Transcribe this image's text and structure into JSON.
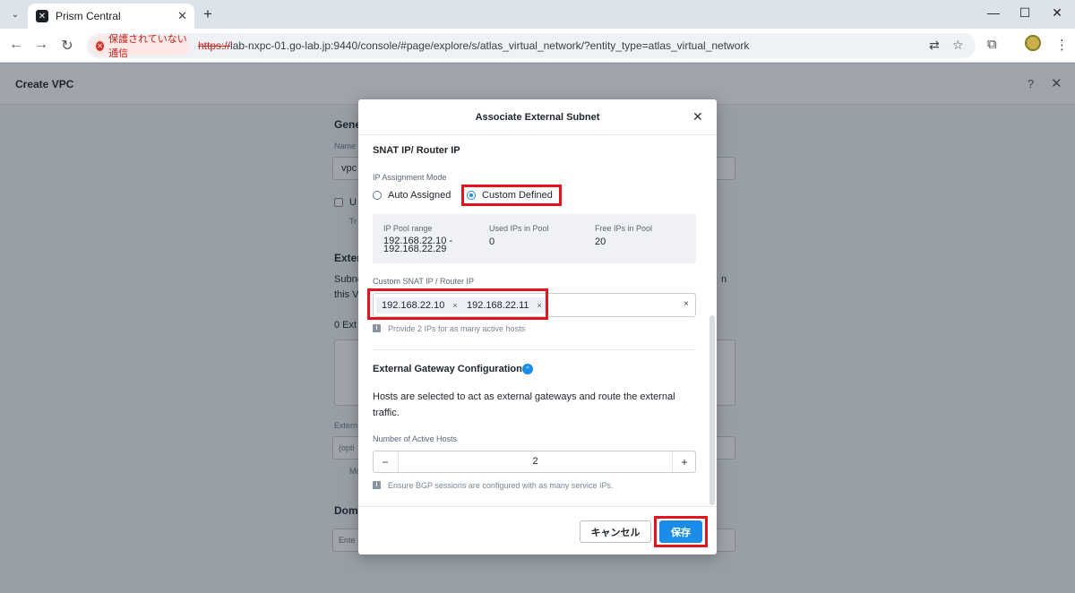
{
  "browser": {
    "tab_title": "Prism Central",
    "security_label": "保護されていない通信",
    "url_scheme": "https://",
    "url_rest": "lab-nxpc-01.go-lab.jp:9440/console/#page/explore/s/atlas_virtual_network/?entity_type=atlas_virtual_network"
  },
  "page": {
    "title": "Create VPC",
    "help": "?",
    "bg_general": "Gene",
    "bg_name_label": "Name",
    "bg_name_value": "vpc",
    "bg_use_label": "U",
    "bg_tr": "Tr",
    "bg_external": "Exter",
    "bg_subnet_line1": "Subne",
    "bg_subnet_line2": "this V",
    "bg_zero_ext": "0 Ext",
    "bg_ext_label": "Extern",
    "bg_opt": "(opti",
    "bg_mo": "Mo",
    "bg_domain": "Doma",
    "bg_enter": "Ente",
    "bg_right_frag1": "n",
    "bg_right_frag2": "o"
  },
  "modal": {
    "title": "Associate External Subnet",
    "snat_title": "SNAT IP/ Router IP",
    "ip_mode_label": "IP Assignment Mode",
    "auto_assigned": "Auto Assigned",
    "custom_defined": "Custom Defined",
    "selected_mode": "Custom Defined",
    "pool_range_label": "IP Pool range",
    "pool_range_value_1": "192.168.22.10 -",
    "pool_range_value_2": "192.168.22.29",
    "used_ips_label": "Used IPs in Pool",
    "used_ips_value": "0",
    "free_ips_label": "Free IPs in Pool",
    "free_ips_value": "20",
    "custom_snat_label": "Custom SNAT IP / Router IP",
    "tags": [
      "192.168.22.10",
      "192.168.22.11"
    ],
    "tag_remove": "×",
    "clear_all": "×",
    "provide_hint": "Provide 2 IPs for as many active hosts",
    "gateway_title": "External Gateway Configuration",
    "gateway_desc_1": "Hosts are selected to act as external gateways and route the external",
    "gateway_desc_2": "traffic.",
    "active_hosts_label": "Number of Active Hosts",
    "active_hosts_value": "2",
    "minus": "−",
    "plus": "+",
    "bgp_hint": "Ensure BGP sessions are configured with as many service IPs.",
    "cancel_label": "キャンセル",
    "save_label": "保存"
  },
  "colors": {
    "accent": "#1b8de8",
    "highlight": "#e4141c"
  }
}
